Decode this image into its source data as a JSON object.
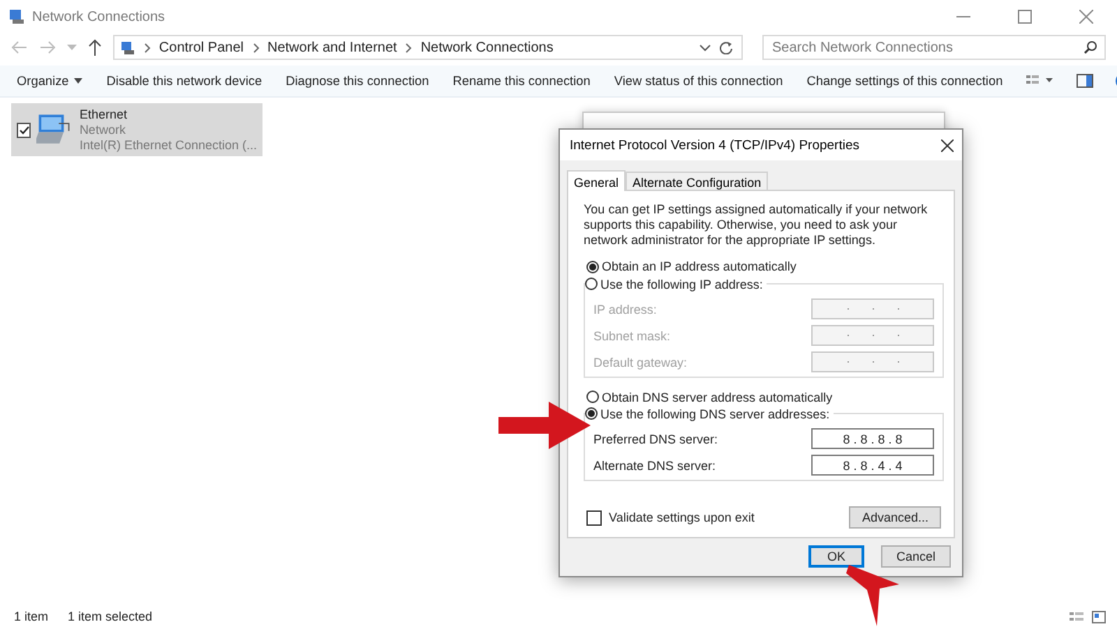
{
  "window": {
    "title": "Network Connections"
  },
  "address": {
    "breadcrumbs": [
      "Control Panel",
      "Network and Internet",
      "Network Connections"
    ],
    "search": {
      "placeholder": "Search Network Connections"
    }
  },
  "toolbar": {
    "items": [
      {
        "label": "Organize",
        "kind": "menu"
      },
      {
        "label": "Disable this network device",
        "kind": "action"
      },
      {
        "label": "Diagnose this connection",
        "kind": "action"
      },
      {
        "label": "Rename this connection",
        "kind": "action"
      },
      {
        "label": "View status of this connection",
        "kind": "action"
      },
      {
        "label": "Change settings of this connection",
        "kind": "action"
      }
    ]
  },
  "connections": [
    {
      "name": "Ethernet",
      "network": "Network",
      "device": "Intel(R) Ethernet Connection (...",
      "checked": true,
      "selected": true
    }
  ],
  "dialog": {
    "title": "Internet Protocol Version 4 (TCP/IPv4) Properties",
    "tabs": [
      {
        "label": "General",
        "selected": true
      },
      {
        "label": "Alternate Configuration",
        "selected": false
      }
    ],
    "intro": "You can get IP settings assigned automatically if your network supports this capability. Otherwise, you need to ask your network administrator for the appropriate IP settings.",
    "ip_options": [
      {
        "label": "Obtain an IP address automatically",
        "selected": true
      },
      {
        "label": "Use the following IP address:",
        "selected": false
      }
    ],
    "ip_fields": [
      {
        "label": "IP address:",
        "disabled": true
      },
      {
        "label": "Subnet mask:",
        "disabled": true
      },
      {
        "label": "Default gateway:",
        "disabled": true
      }
    ],
    "dns_options": [
      {
        "label": "Obtain DNS server address automatically",
        "selected": false
      },
      {
        "label": "Use the following DNS server addresses:",
        "selected": true
      }
    ],
    "dns_fields": [
      {
        "label": "Preferred DNS server:",
        "value": "8 . 8 . 8 . 8",
        "disabled": false
      },
      {
        "label": "Alternate DNS server:",
        "value": "8 . 8 . 4 . 4",
        "disabled": false
      }
    ],
    "validate": {
      "label": "Validate settings upon exit",
      "checked": false
    },
    "buttons": [
      {
        "label": "Advanced...",
        "kind": "secondary"
      },
      {
        "label": "OK",
        "kind": "default"
      },
      {
        "label": "Cancel",
        "kind": "secondary"
      }
    ]
  },
  "status_bar": [
    "1 item",
    "1 item selected"
  ]
}
